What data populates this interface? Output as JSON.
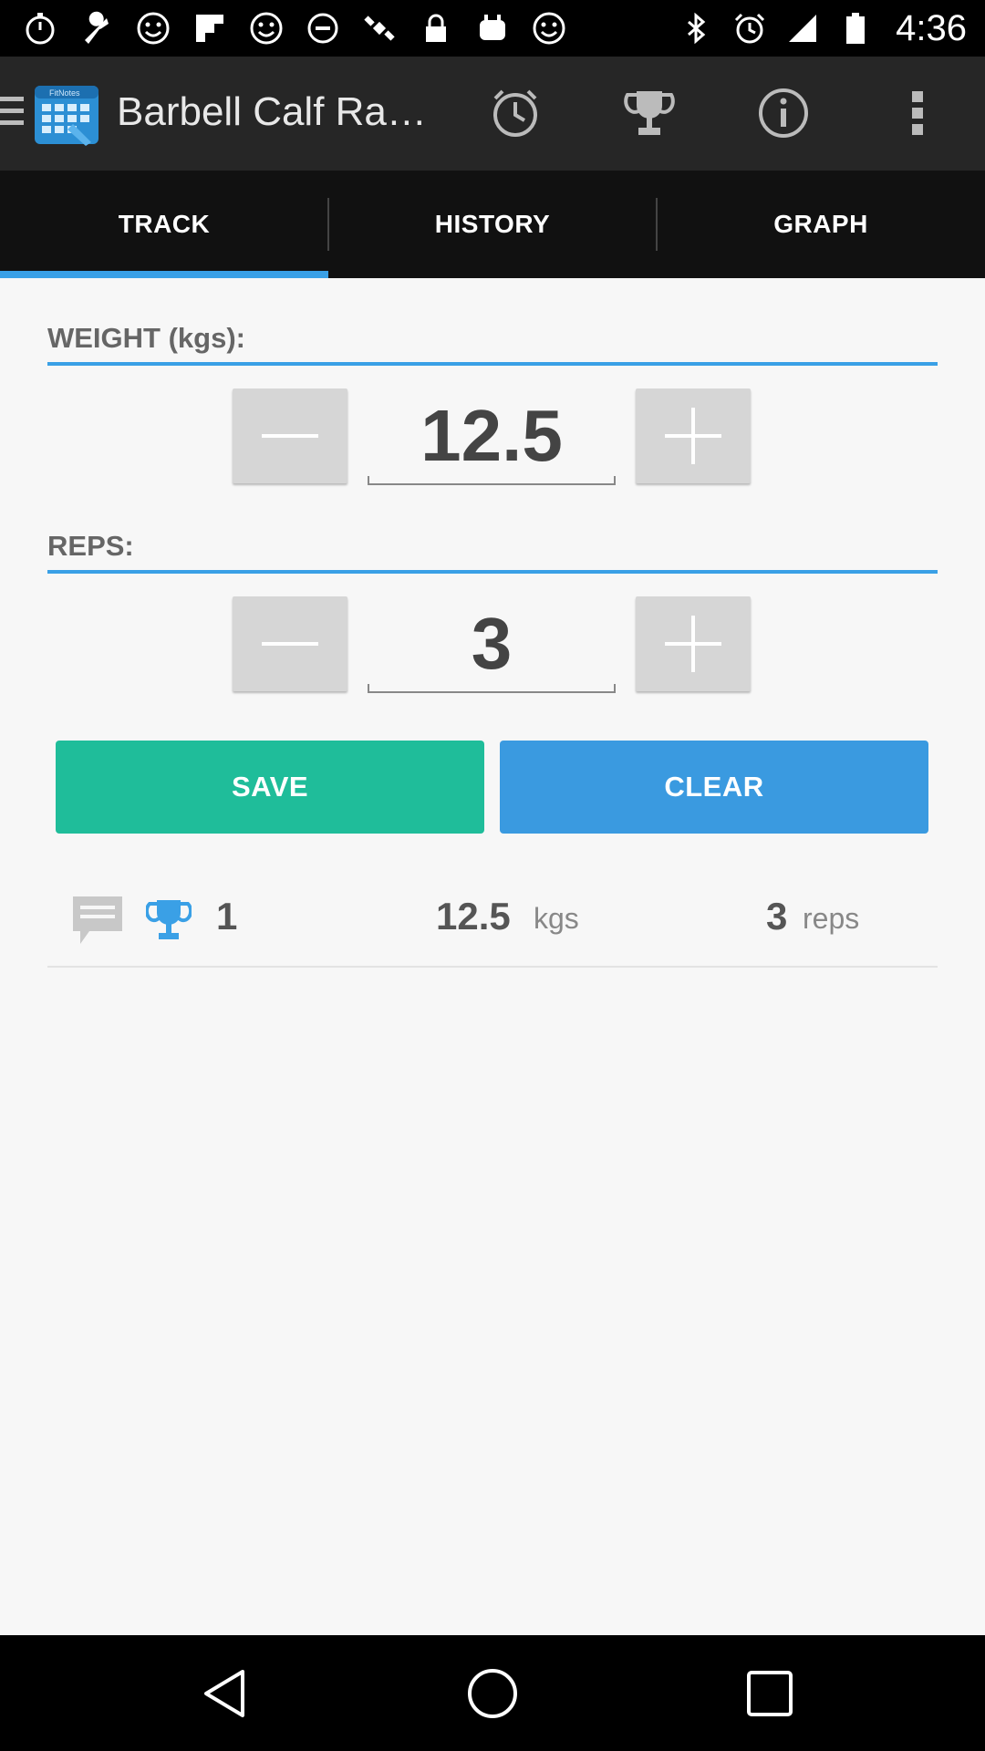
{
  "status_bar": {
    "time": "4:36",
    "left_icons": [
      "stopwatch-icon",
      "wrench-icon",
      "smiley-icon",
      "flipboard-icon",
      "smiley-icon",
      "cancel-circle-icon",
      "satellite-icon",
      "lock-icon",
      "cup-icon",
      "smiley-icon"
    ],
    "right_icons": [
      "bluetooth-icon",
      "alarm-icon",
      "signal-icon",
      "battery-icon"
    ]
  },
  "action_bar": {
    "title": "Barbell Calf Ra…",
    "app_icon": "fitnotes-calendar-icon",
    "app_icon_label": "FitNotes",
    "actions": [
      "timer-icon",
      "trophy-icon",
      "info-icon",
      "overflow-menu-icon"
    ]
  },
  "tabs": [
    {
      "label": "TRACK",
      "active": true
    },
    {
      "label": "HISTORY",
      "active": false
    },
    {
      "label": "GRAPH",
      "active": false
    }
  ],
  "weight": {
    "label": "WEIGHT (kgs):",
    "value": "12.5"
  },
  "reps": {
    "label": "REPS:",
    "value": "3"
  },
  "buttons": {
    "save": "SAVE",
    "clear": "CLEAR"
  },
  "entry": {
    "set_number": "1",
    "weight_value": "12.5",
    "weight_unit": "kgs",
    "reps_value": "3",
    "reps_unit": "reps"
  },
  "colors": {
    "accent": "#3aa0e6",
    "save": "#1fbd9a",
    "clear": "#3a9ae0",
    "trophy": "#3aa0e6"
  },
  "nav_bar": {
    "buttons": [
      "back-icon",
      "home-icon",
      "recents-icon"
    ]
  }
}
